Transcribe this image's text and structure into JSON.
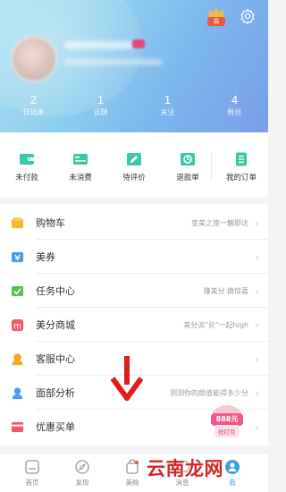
{
  "header": {
    "vip_badge": "易",
    "stats": [
      {
        "value": "2",
        "label": "日记本"
      },
      {
        "value": "1",
        "label": "话题"
      },
      {
        "value": "1",
        "label": "关注"
      },
      {
        "value": "4",
        "label": "粉丝"
      }
    ]
  },
  "orders": [
    {
      "label": "未付款",
      "icon": "wallet-icon"
    },
    {
      "label": "未消费",
      "icon": "ticket-icon"
    },
    {
      "label": "待评价",
      "icon": "review-icon"
    },
    {
      "label": "退款单",
      "icon": "refund-icon"
    },
    {
      "label": "我的订单",
      "icon": "order-list-icon"
    }
  ],
  "menu": [
    {
      "label": "购物车",
      "hint": "变美之旅一触即达",
      "icon": "cart-icon"
    },
    {
      "label": "美券",
      "hint": "",
      "icon": "coupon-icon"
    },
    {
      "label": "任务中心",
      "hint": "赚美分 换惊喜",
      "icon": "task-icon"
    },
    {
      "label": "美分商城",
      "hint": "美分派\"兑\"一起high",
      "icon": "mall-icon"
    },
    {
      "label": "客服中心",
      "hint": "",
      "icon": "service-icon"
    },
    {
      "label": "面部分析",
      "hint": "测测你的颜值能得多少分",
      "icon": "face-icon"
    },
    {
      "label": "优惠买单",
      "hint": "",
      "icon": "discount-icon"
    }
  ],
  "red_packet": {
    "amount": "888元",
    "label": "抢红包"
  },
  "nav": [
    {
      "label": "首页",
      "icon": "home-icon"
    },
    {
      "label": "发现",
      "icon": "compass-icon"
    },
    {
      "label": "美购",
      "icon": "shopping-bag-icon"
    },
    {
      "label": "消息",
      "icon": "message-icon"
    },
    {
      "label": "我",
      "icon": "me-icon"
    }
  ],
  "watermark": "云南龙网",
  "colors": {
    "accent": "#3aa0e6",
    "arrow": "#e21b1b",
    "watermark": "#d62525"
  }
}
